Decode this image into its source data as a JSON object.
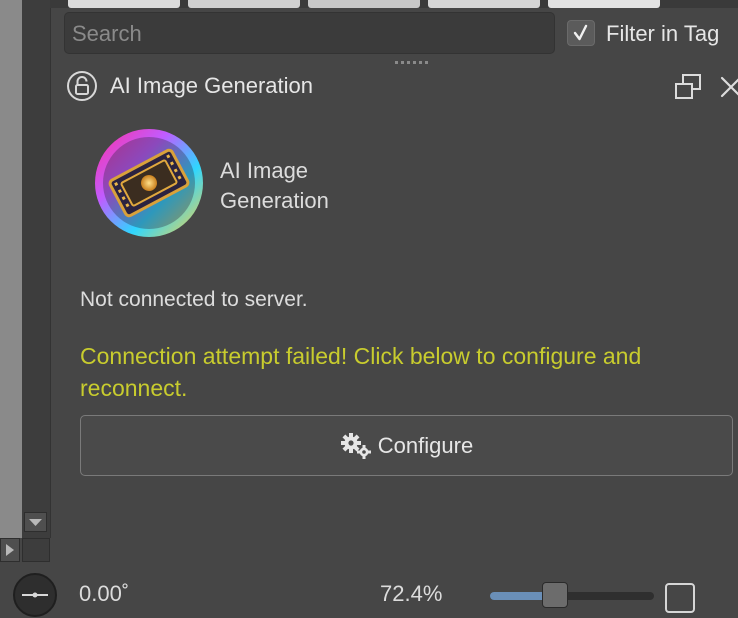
{
  "search": {
    "placeholder": "Search"
  },
  "filter": {
    "label": "Filter in Tag",
    "checked": true
  },
  "panel": {
    "title": "AI Image Generation"
  },
  "logo": {
    "icon": "ai-diffusion-logo"
  },
  "app_name": "AI Image Generation",
  "status": {
    "message": "Not connected to server.",
    "error": "Connection attempt failed! Click below to configure and reconnect."
  },
  "configure_button": {
    "label": "Configure",
    "icon": "gears-icon"
  },
  "footer": {
    "rotation": "0.00˚",
    "zoom": "72.4%",
    "zoom_slider_fraction": 0.4
  },
  "colors": {
    "background": "#464646",
    "error_text": "#c8cc2e",
    "slider_fill": "#6a8fb8"
  }
}
